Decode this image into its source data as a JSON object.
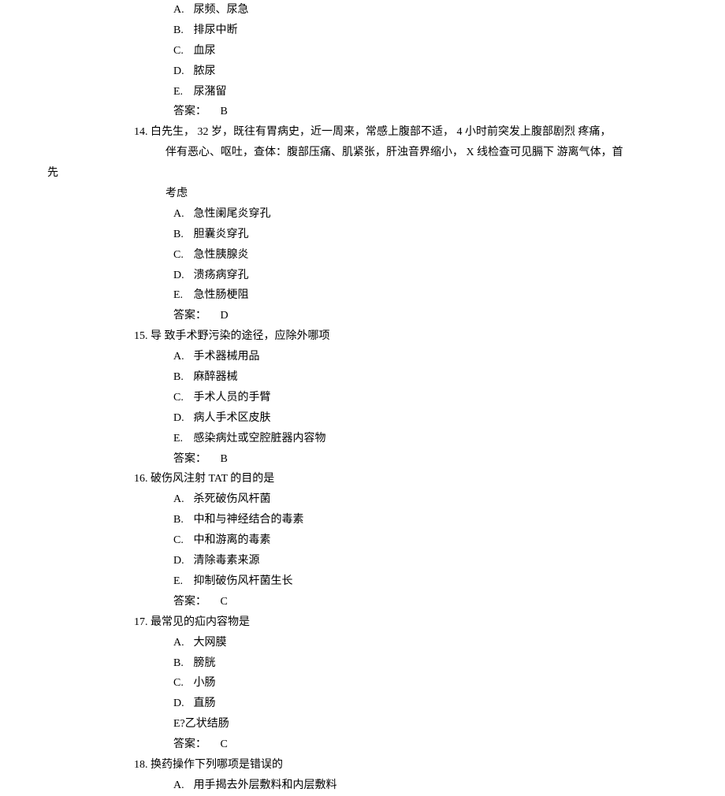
{
  "q13": {
    "options": {
      "A": "尿频、尿急",
      "B": "排尿中断",
      "C": "血尿",
      "D": "脓尿",
      "E": "尿潴留"
    },
    "answer_label": "答案：",
    "answer": "B"
  },
  "q14": {
    "number": "14.",
    "stem_line1": "白先生， 32 岁，既往有胃病史，近一周来，常感上腹部不适， 4 小时前突发上腹部剧烈 疼痛，",
    "stem_line2_part1": "伴有恶心、呕吐，查体：腹部压痛、肌紧张，肝浊音界缩小， X 线检查可见膈下 游离气体，首",
    "stem_line2_part2": "先",
    "stem_line3": "考虑",
    "options": {
      "A": "急性阑尾炎穿孔",
      "B": "胆囊炎穿孔",
      "C": "急性胰腺炎",
      "D": "溃疡病穿孔",
      "E": "急性肠梗阻"
    },
    "answer_label": "答案：",
    "answer": "D"
  },
  "q15": {
    "number": "15.",
    "stem": "导 致手术野污染的途径，应除外哪项",
    "options": {
      "A": "手术器械用品",
      "B": "麻醉器械",
      "C": "手术人员的手臂",
      "D": "病人手术区皮肤",
      "E": "感染病灶或空腔脏器内容物"
    },
    "answer_label": "答案：",
    "answer": "B"
  },
  "q16": {
    "number": "16.",
    "stem": "破伤风注射 TAT 的目的是",
    "options": {
      "A": "杀死破伤风杆菌",
      "B": "中和与神经结合的毒素",
      "C": "中和游离的毒素",
      "D": "清除毒素来源",
      "E": "抑制破伤风杆菌生长"
    },
    "answer_label": "答案：",
    "answer": "C"
  },
  "q17": {
    "number": "17.",
    "stem": "最常见的疝内容物是",
    "options": {
      "A": "大网膜",
      "B": "膀胱",
      "C": "小肠",
      "D": "直肠",
      "E": "E?乙状结肠"
    },
    "answer_label": "答案：",
    "answer": "C"
  },
  "q18": {
    "number": "18.",
    "stem": "换药操作下列哪项是错误的",
    "options": {
      "A": "用手揭去外层敷料和内层敷料"
    }
  },
  "labels": {
    "A": "A.",
    "B": "B.",
    "C": "C.",
    "D": "D.",
    "E": "E."
  }
}
